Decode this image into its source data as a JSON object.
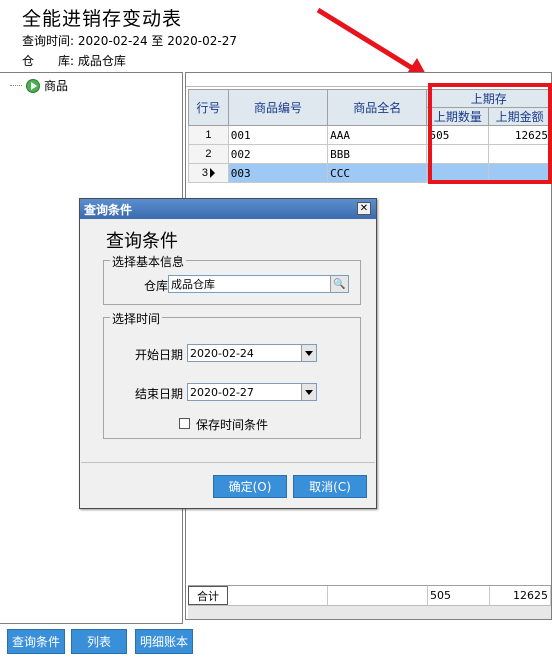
{
  "header": {
    "title": "全能进销存变动表",
    "query_time_label": "查询时间:",
    "query_time_value": "2020-02-24 至 2020-02-27",
    "warehouse_label": "仓　　库:",
    "warehouse_value": "成品仓库"
  },
  "tree": {
    "root_label": "商品"
  },
  "grid": {
    "headers": {
      "row_no": "行号",
      "code": "商品编号",
      "name": "商品全名",
      "group": "上期存",
      "qty": "上期数量",
      "amount": "上期金额"
    },
    "rows": [
      {
        "no": "1",
        "code": "001",
        "name": "AAA",
        "qty": "505",
        "amount": "12625"
      },
      {
        "no": "2",
        "code": "002",
        "name": "BBB",
        "qty": "",
        "amount": ""
      },
      {
        "no": "3",
        "code": "003",
        "name": "CCC",
        "qty": "",
        "amount": ""
      }
    ],
    "footer": {
      "label": "合计",
      "qty": "505",
      "amount": "12625"
    }
  },
  "buttons": {
    "query": "查询条件",
    "list": "列表",
    "detail": "明细账本"
  },
  "dialog": {
    "title": "查询条件",
    "heading": "查询条件",
    "group_basic": "选择基本信息",
    "warehouse_label": "仓库",
    "warehouse_value": "成品仓库",
    "group_time": "选择时间",
    "start_label": "开始日期",
    "start_value": "2020-02-24",
    "end_label": "结束日期",
    "end_value": "2020-02-27",
    "save_time_label": "保存时间条件",
    "ok_label": "确定(O)",
    "cancel_label": "取消(C)"
  },
  "colors": {
    "accent_button": "#3a8fd9",
    "highlight_box": "#e8141c",
    "selected_row": "#9ec9f5"
  }
}
